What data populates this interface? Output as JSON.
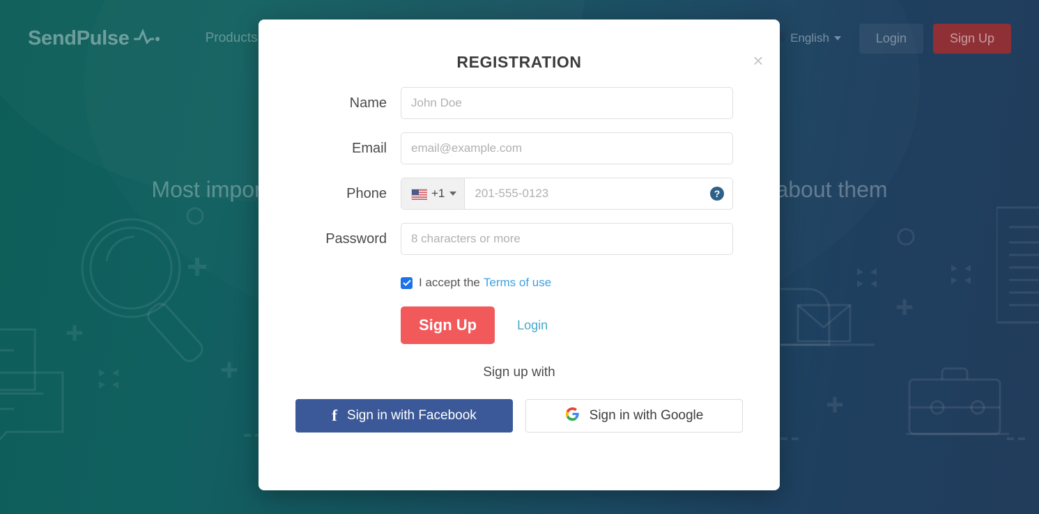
{
  "header": {
    "logo": "SendPulse",
    "logo_icon": "pulse-icon",
    "products": "Products",
    "language": "English",
    "language_icon": "globe-icon",
    "login": "Login",
    "signup": "Sign Up"
  },
  "hero": {
    "text_left": "Most impor",
    "text_right": "about them"
  },
  "modal": {
    "title": "REGISTRATION",
    "close_icon": "×",
    "fields": [
      {
        "label": "Name",
        "placeholder": "John Doe",
        "value": "",
        "name": "name"
      },
      {
        "label": "Email",
        "placeholder": "email@example.com",
        "value": "",
        "name": "email"
      },
      {
        "label": "Phone",
        "placeholder": "201-555-0123",
        "value": "",
        "name": "phone"
      },
      {
        "label": "Password",
        "placeholder": "8 characters or more",
        "value": "",
        "name": "password"
      }
    ],
    "phone": {
      "country_code": "+1",
      "country_flag": "us-flag-icon",
      "help_icon": "?"
    },
    "terms": {
      "text": "I accept the",
      "link": "Terms of use",
      "checked": true
    },
    "signup_button": "Sign Up",
    "login_link": "Login",
    "signup_with": "Sign up with",
    "facebook_button": "Sign in with Facebook",
    "google_button": "Sign in with Google"
  },
  "colors": {
    "accent_red": "#f1595b",
    "link_blue": "#3fa0df",
    "link_teal": "#47a8c9",
    "facebook_blue": "#3b5998",
    "checkbox_blue": "#1a73e8",
    "bg_teal": "#0d5e59",
    "bg_blue": "#223c5b"
  }
}
